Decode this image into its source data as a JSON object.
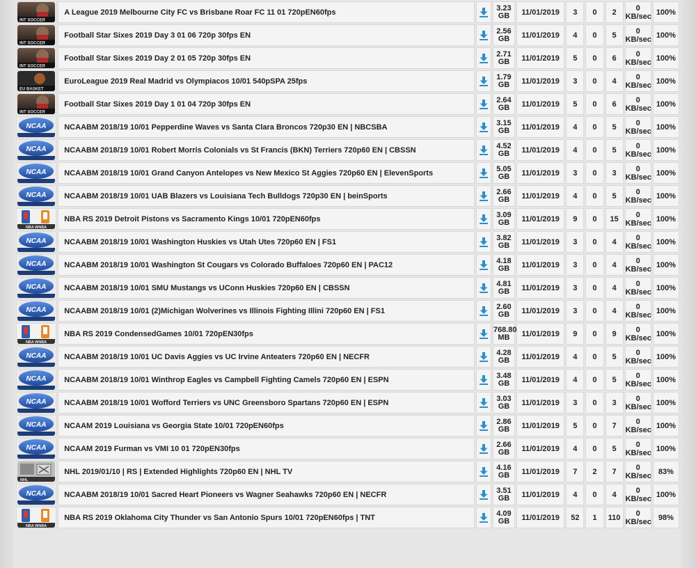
{
  "columns": {
    "download_icon": "download-icon"
  },
  "rows": [
    {
      "category": "soccer",
      "thumb_text": "INT SOCCER",
      "name": "A League 2019 Melbourne City FC vs Brisbane Roar FC 11 01 720pEN60fps",
      "size": "3.23",
      "unit": "GB",
      "date": "11/01/2019",
      "seeders": "3",
      "leechers": "0",
      "completed": "2",
      "speed": "0",
      "speed_unit": "KB/sec",
      "progress": "100%"
    },
    {
      "category": "soccer",
      "thumb_text": "INT SOCCER",
      "name": "Football Star Sixes 2019 Day 3 01 06 720p 30fps EN",
      "size": "2.56",
      "unit": "GB",
      "date": "11/01/2019",
      "seeders": "4",
      "leechers": "0",
      "completed": "5",
      "speed": "0",
      "speed_unit": "KB/sec",
      "progress": "100%"
    },
    {
      "category": "soccer",
      "thumb_text": "INT SOCCER",
      "name": "Football Star Sixes 2019 Day 2 01 05 720p 30fps EN",
      "size": "2.71",
      "unit": "GB",
      "date": "11/01/2019",
      "seeders": "5",
      "leechers": "0",
      "completed": "6",
      "speed": "0",
      "speed_unit": "KB/sec",
      "progress": "100%"
    },
    {
      "category": "basket",
      "thumb_text": "EU BASKET",
      "name": "EuroLeague 2019 Real Madrid vs Olympiacos 10/01 540pSPA 25fps",
      "size": "1.79",
      "unit": "GB",
      "date": "11/01/2019",
      "seeders": "3",
      "leechers": "0",
      "completed": "4",
      "speed": "0",
      "speed_unit": "KB/sec",
      "progress": "100%"
    },
    {
      "category": "soccer",
      "thumb_text": "INT SOCCER",
      "name": "Football Star Sixes 2019 Day 1 01 04 720p 30fps EN",
      "size": "2.64",
      "unit": "GB",
      "date": "11/01/2019",
      "seeders": "5",
      "leechers": "0",
      "completed": "6",
      "speed": "0",
      "speed_unit": "KB/sec",
      "progress": "100%"
    },
    {
      "category": "ncaa",
      "thumb_text": "NCAA",
      "name": "NCAABM 2018/19 10/01 Pepperdine Waves vs Santa Clara Broncos 720p30 EN | NBCSBA",
      "size": "3.15",
      "unit": "GB",
      "date": "11/01/2019",
      "seeders": "4",
      "leechers": "0",
      "completed": "5",
      "speed": "0",
      "speed_unit": "KB/sec",
      "progress": "100%"
    },
    {
      "category": "ncaa",
      "thumb_text": "NCAA",
      "name": "NCAABM 2018/19 10/01 Robert Morris Colonials vs St Francis (BKN) Terriers 720p60 EN | CBSSN",
      "size": "4.52",
      "unit": "GB",
      "date": "11/01/2019",
      "seeders": "4",
      "leechers": "0",
      "completed": "5",
      "speed": "0",
      "speed_unit": "KB/sec",
      "progress": "100%"
    },
    {
      "category": "ncaa",
      "thumb_text": "NCAA",
      "name": "NCAABM 2018/19 10/01 Grand Canyon Antelopes vs New Mexico St Aggies 720p60 EN | ElevenSports",
      "size": "5.05",
      "unit": "GB",
      "date": "11/01/2019",
      "seeders": "3",
      "leechers": "0",
      "completed": "3",
      "speed": "0",
      "speed_unit": "KB/sec",
      "progress": "100%"
    },
    {
      "category": "ncaa",
      "thumb_text": "NCAA",
      "name": "NCAABM 2018/19 10/01 UAB Blazers vs Louisiana Tech Bulldogs 720p30 EN | beinSports",
      "size": "2.66",
      "unit": "GB",
      "date": "11/01/2019",
      "seeders": "4",
      "leechers": "0",
      "completed": "5",
      "speed": "0",
      "speed_unit": "KB/sec",
      "progress": "100%"
    },
    {
      "category": "nba",
      "thumb_text": "NBA WNBA",
      "name": "NBA RS 2019 Detroit Pistons vs Sacramento Kings 10/01 720pEN60fps",
      "size": "3.09",
      "unit": "GB",
      "date": "11/01/2019",
      "seeders": "9",
      "leechers": "0",
      "completed": "15",
      "speed": "0",
      "speed_unit": "KB/sec",
      "progress": "100%"
    },
    {
      "category": "ncaa",
      "thumb_text": "NCAA",
      "name": "NCAABM 2018/19 10/01 Washington Huskies vs Utah Utes 720p60 EN | FS1",
      "size": "3.82",
      "unit": "GB",
      "date": "11/01/2019",
      "seeders": "3",
      "leechers": "0",
      "completed": "4",
      "speed": "0",
      "speed_unit": "KB/sec",
      "progress": "100%"
    },
    {
      "category": "ncaa",
      "thumb_text": "NCAA",
      "name": "NCAABM 2018/19 10/01 Washington St Cougars vs Colorado Buffaloes 720p60 EN | PAC12",
      "size": "4.18",
      "unit": "GB",
      "date": "11/01/2019",
      "seeders": "3",
      "leechers": "0",
      "completed": "4",
      "speed": "0",
      "speed_unit": "KB/sec",
      "progress": "100%"
    },
    {
      "category": "ncaa",
      "thumb_text": "NCAA",
      "name": "NCAABM 2018/19 10/01 SMU Mustangs vs UConn Huskies 720p60 EN | CBSSN",
      "size": "4.81",
      "unit": "GB",
      "date": "11/01/2019",
      "seeders": "3",
      "leechers": "0",
      "completed": "4",
      "speed": "0",
      "speed_unit": "KB/sec",
      "progress": "100%"
    },
    {
      "category": "ncaa",
      "thumb_text": "NCAA",
      "name": "NCAABM 2018/19 10/01 (2)Michigan Wolverines vs Illinois Fighting Illini 720p60 EN | FS1",
      "size": "2.60",
      "unit": "GB",
      "date": "11/01/2019",
      "seeders": "3",
      "leechers": "0",
      "completed": "4",
      "speed": "0",
      "speed_unit": "KB/sec",
      "progress": "100%"
    },
    {
      "category": "nba",
      "thumb_text": "NBA WNBA",
      "name": "NBA RS 2019 CondensedGames 10/01 720pEN30fps",
      "size": "768.80",
      "unit": "MB",
      "date": "11/01/2019",
      "seeders": "9",
      "leechers": "0",
      "completed": "9",
      "speed": "0",
      "speed_unit": "KB/sec",
      "progress": "100%"
    },
    {
      "category": "ncaa",
      "thumb_text": "NCAA",
      "name": "NCAABM 2018/19 10/01 UC Davis Aggies vs UC Irvine Anteaters 720p60 EN | NECFR",
      "size": "4.28",
      "unit": "GB",
      "date": "11/01/2019",
      "seeders": "4",
      "leechers": "0",
      "completed": "5",
      "speed": "0",
      "speed_unit": "KB/sec",
      "progress": "100%"
    },
    {
      "category": "ncaa",
      "thumb_text": "NCAA",
      "name": "NCAABM 2018/19 10/01 Winthrop Eagles vs Campbell Fighting Camels 720p60 EN | ESPN",
      "size": "3.48",
      "unit": "GB",
      "date": "11/01/2019",
      "seeders": "4",
      "leechers": "0",
      "completed": "5",
      "speed": "0",
      "speed_unit": "KB/sec",
      "progress": "100%"
    },
    {
      "category": "ncaa",
      "thumb_text": "NCAA",
      "name": "NCAABM 2018/19 10/01 Wofford Terriers vs UNC Greensboro Spartans 720p60 EN | ESPN",
      "size": "3.03",
      "unit": "GB",
      "date": "11/01/2019",
      "seeders": "3",
      "leechers": "0",
      "completed": "3",
      "speed": "0",
      "speed_unit": "KB/sec",
      "progress": "100%"
    },
    {
      "category": "ncaa",
      "thumb_text": "NCAA",
      "name": "NCAAM 2019 Louisiana vs Georgia State 10/01 720pEN60fps",
      "size": "2.86",
      "unit": "GB",
      "date": "11/01/2019",
      "seeders": "5",
      "leechers": "0",
      "completed": "7",
      "speed": "0",
      "speed_unit": "KB/sec",
      "progress": "100%"
    },
    {
      "category": "ncaa",
      "thumb_text": "NCAA",
      "name": "NCAAM 2019 Furman vs VMI 10 01 720pEN30fps",
      "size": "2.66",
      "unit": "GB",
      "date": "11/01/2019",
      "seeders": "4",
      "leechers": "0",
      "completed": "5",
      "speed": "0",
      "speed_unit": "KB/sec",
      "progress": "100%"
    },
    {
      "category": "nhl",
      "thumb_text": "NHL",
      "name": "NHL 2019/01/10 | RS | Extended Highlights 720p60 EN | NHL TV",
      "size": "4.16",
      "unit": "GB",
      "date": "11/01/2019",
      "seeders": "7",
      "leechers": "2",
      "completed": "7",
      "speed": "0",
      "speed_unit": "KB/sec",
      "progress": "83%"
    },
    {
      "category": "ncaa",
      "thumb_text": "NCAA",
      "name": "NCAABM 2018/19 10/01 Sacred Heart Pioneers vs Wagner Seahawks 720p60 EN | NECFR",
      "size": "3.51",
      "unit": "GB",
      "date": "11/01/2019",
      "seeders": "4",
      "leechers": "0",
      "completed": "4",
      "speed": "0",
      "speed_unit": "KB/sec",
      "progress": "100%"
    },
    {
      "category": "nba",
      "thumb_text": "NBA WNBA",
      "name": "NBA RS 2019 Oklahoma City Thunder vs San Antonio Spurs 10/01 720pEN60fps | TNT",
      "size": "4.09",
      "unit": "GB",
      "date": "11/01/2019",
      "seeders": "52",
      "leechers": "1",
      "completed": "110",
      "speed": "0",
      "speed_unit": "KB/sec",
      "progress": "98%"
    }
  ],
  "colors": {
    "download_icon": "#2a8fc7",
    "ncaa_blue": "#2e63b8",
    "soccer_dark": "#3a2a22",
    "nba_orange": "#e8892b"
  }
}
